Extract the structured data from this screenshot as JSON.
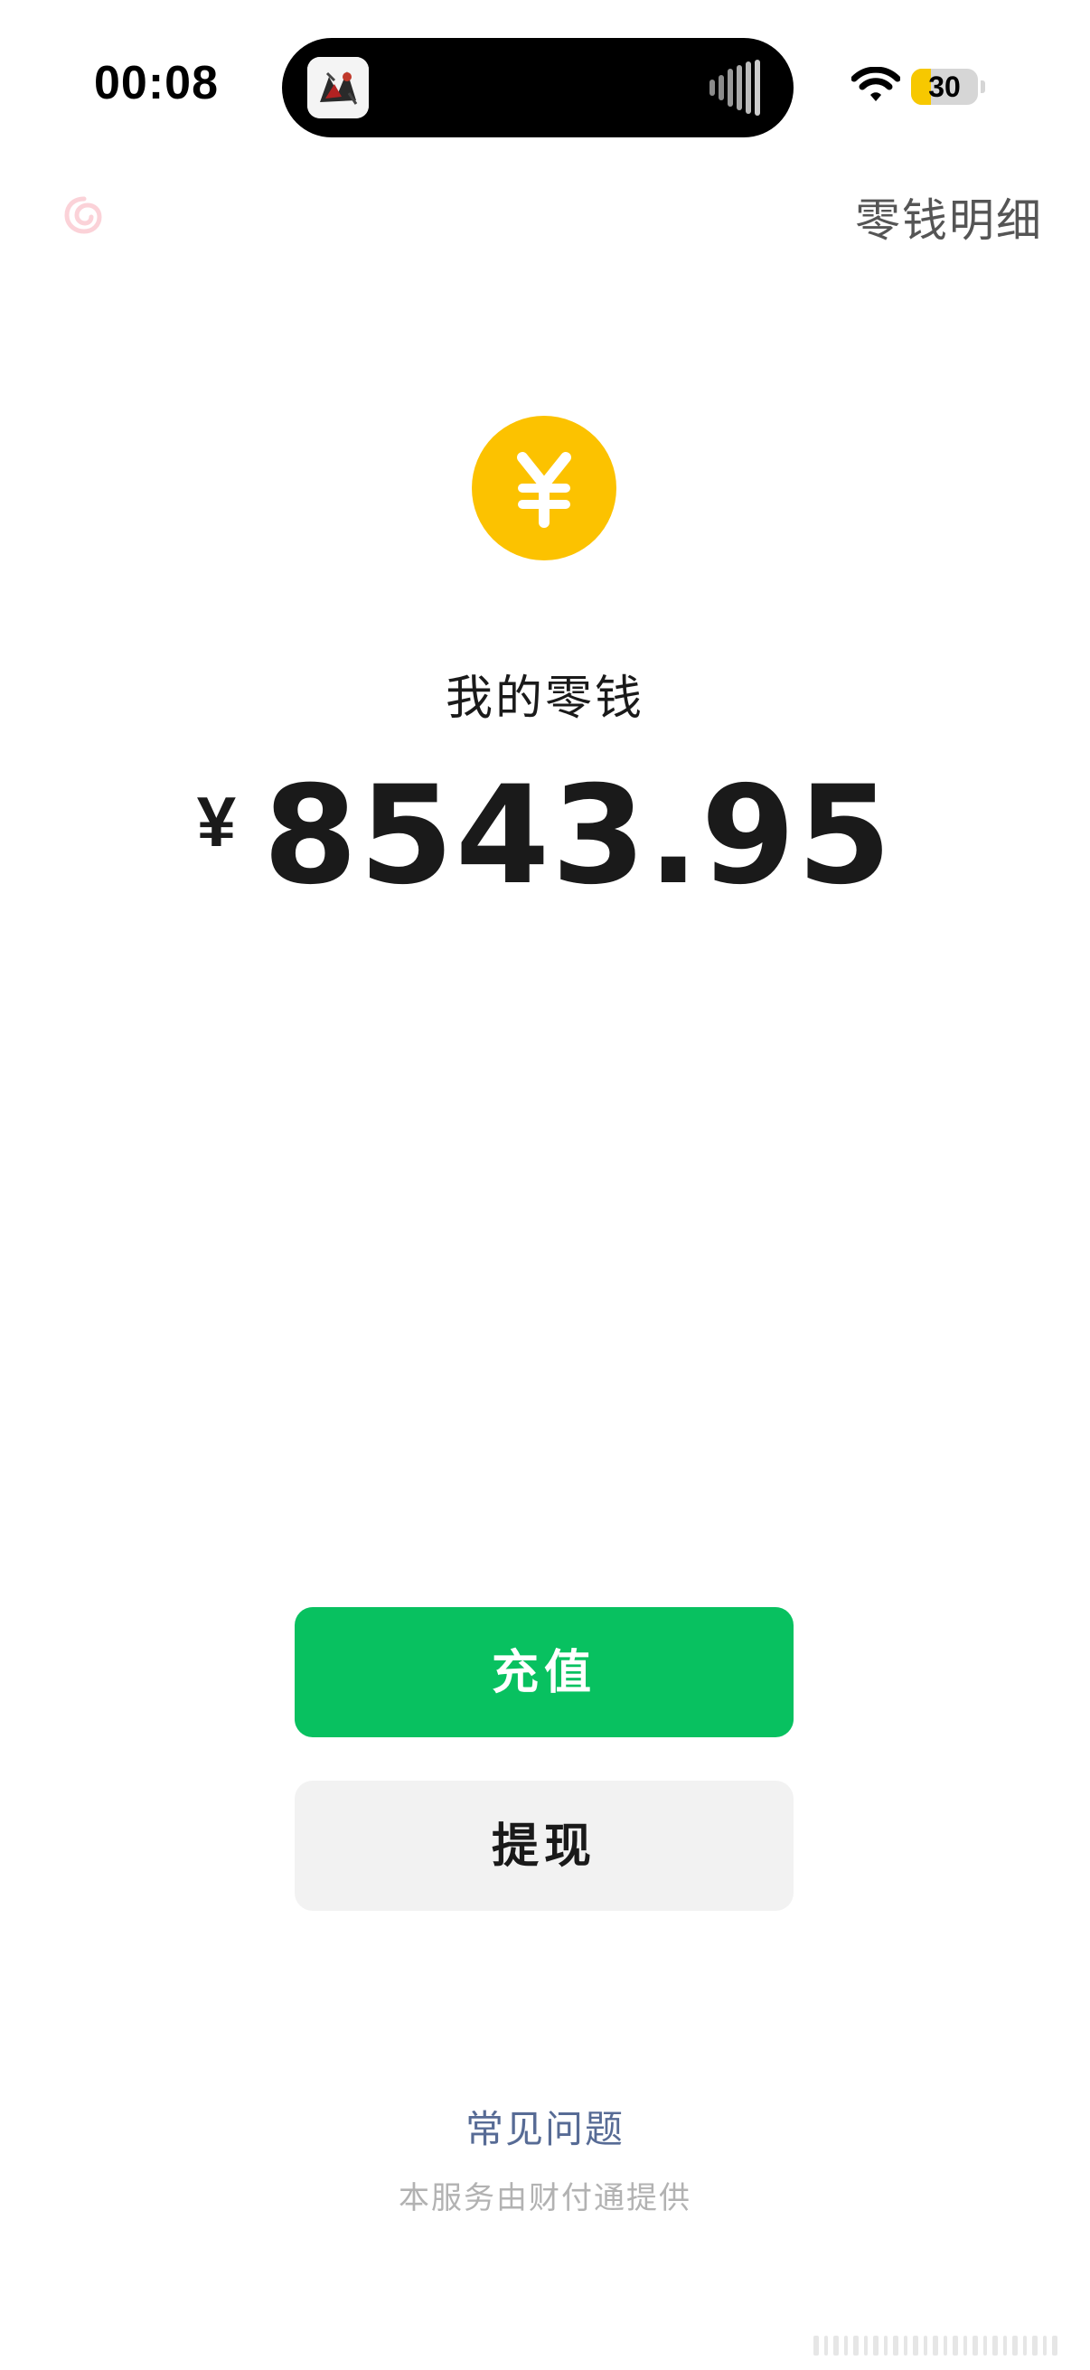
{
  "status_bar": {
    "time": "00:08",
    "battery_level": "30",
    "battery_fraction": 0.3,
    "battery_color": "#f7c800",
    "icons": [
      "wifi-icon",
      "battery-icon",
      "audio-wave-icon"
    ]
  },
  "nav": {
    "back_icon": "back-swirl-icon",
    "detail_link": "零钱明细"
  },
  "balance": {
    "coin_icon": "yuan-coin-icon",
    "coin_color": "#fcc200",
    "label": "我的零钱",
    "currency": "¥",
    "amount": "8543.95"
  },
  "actions": {
    "recharge_label": "充值",
    "recharge_color": "#08c160",
    "withdraw_label": "提现"
  },
  "footer": {
    "faq_label": "常见问题",
    "provider_text": "本服务由财付通提供"
  }
}
